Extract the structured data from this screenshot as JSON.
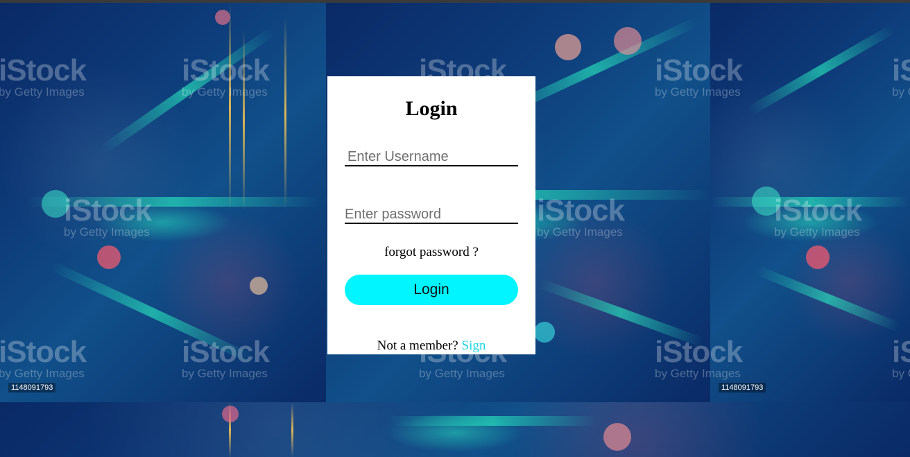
{
  "login": {
    "title": "Login",
    "username_placeholder": "Enter Username",
    "password_placeholder": "Enter password",
    "forgot_label": "forgot password ?",
    "login_button_label": "Login",
    "footer_text": "Not a member?",
    "sign_link_label": "Sign"
  },
  "background": {
    "watermark_brand": "iStock",
    "watermark_sub": "by Getty Images",
    "image_id": "1148091793"
  },
  "colors": {
    "button": "#00f5ff",
    "link": "#19d6e6",
    "card": "#ffffff"
  }
}
